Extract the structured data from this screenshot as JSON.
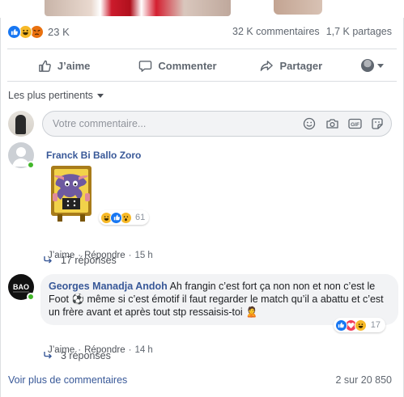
{
  "post": {
    "reaction_total": "23 K",
    "reaction_icons": [
      "like-icon",
      "haha-icon",
      "angry-icon"
    ],
    "comments_count": "32 K commentaires",
    "shares_count": "1,7 K partages"
  },
  "actions": {
    "like_label": "J’aime",
    "comment_label": "Commenter",
    "share_label": "Partager"
  },
  "sort": {
    "label": "Les plus pertinents"
  },
  "composer": {
    "placeholder": "Votre commentaire..."
  },
  "comments": [
    {
      "author": "Franck Bi Ballo Zoro",
      "content_type": "sticker",
      "reaction_icons": [
        "haha-icon",
        "like-icon",
        "wow-icon"
      ],
      "reaction_count": "61",
      "like_label": "J’aime",
      "reply_label": "Répondre",
      "time": "15 h",
      "replies_label": "17 réponses"
    },
    {
      "author": "Georges Manadja Andoh",
      "text": "Ah frangin c’est fort ça non non et non c’est le Foot ⚽ même si c’est émotif il faut regarder le match qu’il a abattu et c’est un frère avant et après tout stp ressaisis-toi 🙎",
      "reaction_icons": [
        "like-icon",
        "love-icon",
        "haha-icon"
      ],
      "reaction_count": "17",
      "like_label": "J’aime",
      "reply_label": "Répondre",
      "time": "14 h",
      "replies_label": "3 réponses"
    }
  ],
  "footer": {
    "more_label": "Voir plus de commentaires",
    "count": "2 sur 20 850"
  },
  "colors": {
    "link_blue": "#385898",
    "like_blue": "#1877f2",
    "online_green": "#42b72a"
  }
}
